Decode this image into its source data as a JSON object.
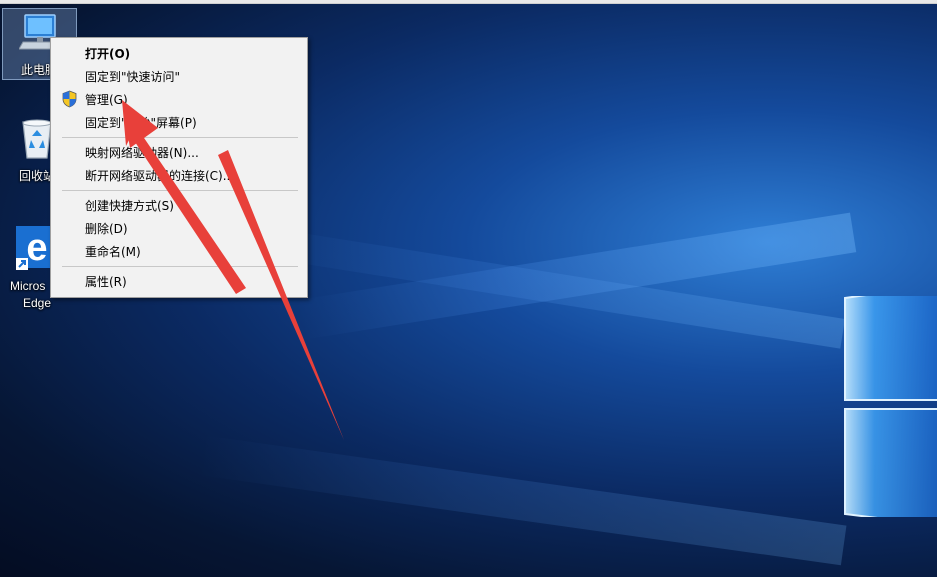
{
  "desktop": {
    "icons": [
      {
        "label": "此电脑",
        "icon": "this-pc-icon"
      },
      {
        "label": "回收站",
        "icon": "recycle-bin-icon"
      },
      {
        "label": "Microsoft Edge",
        "label_line1": "Micros",
        "label_line2": "Edge",
        "icon": "edge-icon"
      }
    ]
  },
  "context_menu": {
    "items": [
      {
        "label": "打开(O)",
        "bold": true
      },
      {
        "label": "固定到\"快速访问\""
      },
      {
        "label": "管理(G)",
        "icon": "uac-shield-icon"
      },
      {
        "label": "固定到\"开始\"屏幕(P)"
      },
      {
        "label": "映射网络驱动器(N)..."
      },
      {
        "label": "断开网络驱动器的连接(C)..."
      },
      {
        "label": "创建快捷方式(S)"
      },
      {
        "label": "删除(D)"
      },
      {
        "label": "重命名(M)"
      },
      {
        "label": "属性(R)"
      }
    ]
  },
  "annotation": {
    "color": "#e8403a",
    "icon": "red-arrow-icon"
  },
  "colors": {
    "menu_bg": "#f2f2f2",
    "desktop_accent": "#2f7fd6"
  }
}
